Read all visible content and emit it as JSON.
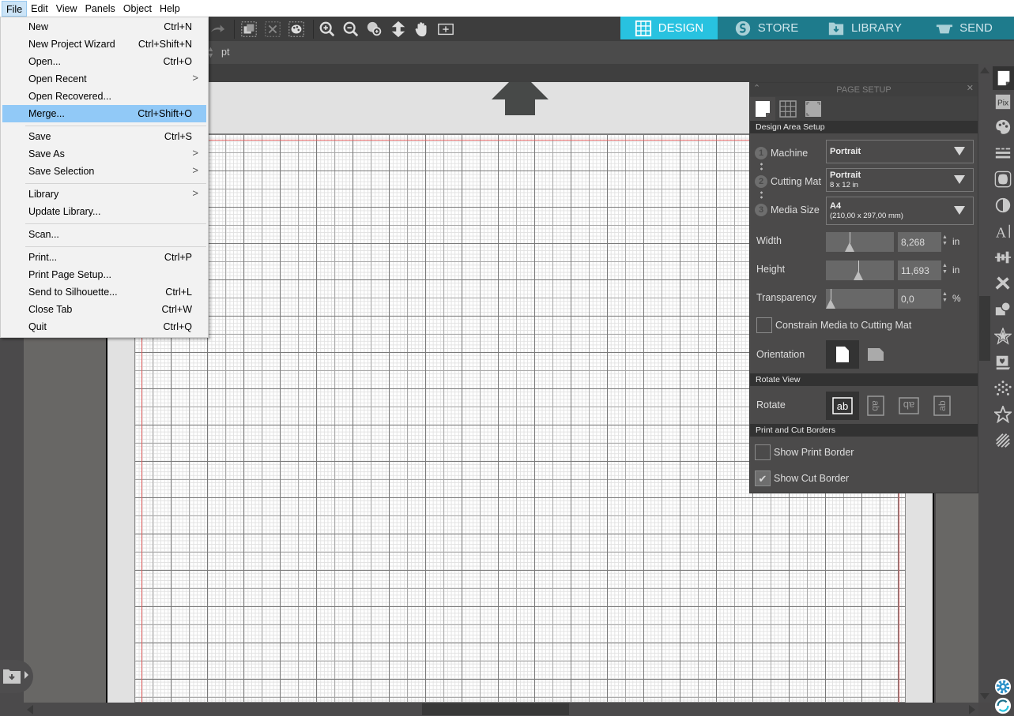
{
  "menubar": {
    "items": [
      "File",
      "Edit",
      "View",
      "Panels",
      "Object",
      "Help"
    ],
    "active": "File"
  },
  "file_menu": {
    "items": [
      {
        "label": "New",
        "shortcut": "Ctrl+N"
      },
      {
        "label": "New Project Wizard",
        "shortcut": "Ctrl+Shift+N"
      },
      {
        "label": "Open...",
        "shortcut": "Ctrl+O"
      },
      {
        "label": "Open Recent",
        "submenu": ">"
      },
      {
        "label": "Open Recovered..."
      },
      {
        "label": "Merge...",
        "shortcut": "Ctrl+Shift+O",
        "highlighted": true
      },
      {
        "label": "Save",
        "shortcut": "Ctrl+S"
      },
      {
        "label": "Save As",
        "submenu": ">"
      },
      {
        "label": "Save Selection",
        "submenu": ">"
      },
      {
        "label": "Library",
        "submenu": ">"
      },
      {
        "label": "Update Library..."
      },
      {
        "label": "Scan..."
      },
      {
        "label": "Print...",
        "shortcut": "Ctrl+P"
      },
      {
        "label": "Print Page Setup..."
      },
      {
        "label": "Send to Silhouette...",
        "shortcut": "Ctrl+L"
      },
      {
        "label": "Close Tab",
        "shortcut": "Ctrl+W"
      },
      {
        "label": "Quit",
        "shortcut": "Ctrl+Q"
      }
    ]
  },
  "toolbar": {
    "icons": [
      "redo-icon",
      "group-icon",
      "ungroup-icon",
      "fill-color-icon",
      "zoom-in-icon",
      "zoom-out-icon",
      "zoom-selection-icon",
      "fit-icon",
      "pan-hand-icon",
      "fit-page-icon"
    ],
    "unit_label": "pt"
  },
  "nav_tabs": [
    {
      "label": "DESIGN",
      "icon": "grid-icon",
      "active": true
    },
    {
      "label": "STORE",
      "icon": "silhouette-s-icon"
    },
    {
      "label": "LIBRARY",
      "icon": "library-folder-icon"
    },
    {
      "label": "SEND",
      "icon": "cutter-icon"
    }
  ],
  "colors": {
    "accent": "#28c2e0",
    "nav_bg": "#1e7b8c",
    "menu_highlight": "#91c9f7",
    "cut_border": "#e06060"
  },
  "page_setup": {
    "title": "PAGE SETUP",
    "sections": {
      "design_area": "Design Area Setup",
      "rotate_view": "Rotate View",
      "borders": "Print and Cut Borders"
    },
    "machine": {
      "step": "1",
      "label": "Machine",
      "value": "Portrait"
    },
    "cutting_mat": {
      "step": "2",
      "label": "Cutting Mat",
      "value": "Portrait",
      "detail": "8 x 12 in"
    },
    "media_size": {
      "step": "3",
      "label": "Media Size",
      "value": "A4",
      "detail": "(210,00 x 297,00 mm)"
    },
    "width": {
      "label": "Width",
      "value": "8,268",
      "unit": "in",
      "slider_fraction": 0.33
    },
    "height": {
      "label": "Height",
      "value": "11,693",
      "unit": "in",
      "slider_fraction": 0.47
    },
    "transparency": {
      "label": "Transparency",
      "value": "0,0",
      "unit": "%",
      "slider_fraction": 0.0
    },
    "constrain": {
      "label": "Constrain Media to Cutting Mat",
      "checked": false
    },
    "orientation": {
      "label": "Orientation",
      "selected": "portrait"
    },
    "rotate": {
      "label": "Rotate",
      "selected": 0,
      "options": [
        "ab",
        "ab-90",
        "ab-180",
        "ab-270"
      ]
    },
    "show_print_border": {
      "label": "Show Print Border",
      "checked": false
    },
    "show_cut_border": {
      "label": "Show Cut Border",
      "checked": true
    }
  },
  "right_bar_icons": [
    "page-setup-icon",
    "pixscan-icon",
    "fill-palette-icon",
    "line-style-icon",
    "trace-icon",
    "transparency-icon",
    "text-style-icon",
    "align-icon",
    "replicate-icon",
    "modify-icon",
    "offset-star-icon",
    "sketch-icon",
    "rhinestone-icon",
    "star-icon",
    "hatch-icon"
  ],
  "bottom_right_icons": [
    "settings-gear-icon",
    "sync-icon"
  ]
}
